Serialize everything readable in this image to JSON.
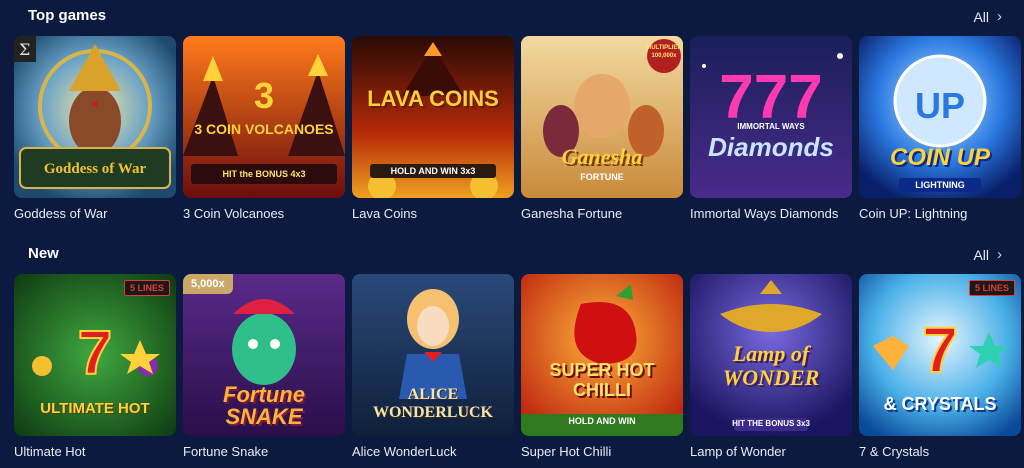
{
  "colors": {
    "background": "#0b1a3e",
    "label": "#e8ecf6",
    "accent": "#e53935"
  },
  "sections": {
    "top": {
      "title": "Top games",
      "all_label": "All",
      "games": [
        {
          "name": "Goddess of War",
          "art_text": "Goddess of War"
        },
        {
          "name": "3 Coin Volcanoes",
          "art_text": "3 COIN VOLCANOES",
          "art_sub": "HIT the BONUS 4x3"
        },
        {
          "name": "Lava Coins",
          "art_text": "LAVA COINS",
          "art_sub": "HOLD AND WIN 3x3"
        },
        {
          "name": "Ganesha Fortune",
          "art_text": "Ganesha",
          "art_sub": "FORTUNE",
          "art_badge": "MULTIPLIER 100,000x"
        },
        {
          "name": "Immortal Ways Diamonds",
          "art_text": "Diamonds",
          "art_sub": "IMMORTAL WAYS"
        },
        {
          "name": "Coin UP: Lightning",
          "art_text": "COIN UP",
          "art_sub": "LIGHTNING"
        }
      ]
    },
    "new": {
      "title": "New",
      "all_label": "All",
      "games": [
        {
          "name": "Ultimate Hot",
          "art_text": "ULTIMATE HOT",
          "badge": "5 LINES"
        },
        {
          "name": "Fortune Snake",
          "art_text": "Fortune SNAKE",
          "badge": "5,000x"
        },
        {
          "name": "Alice WonderLuck",
          "art_text": "ALICE WONDERLUCK"
        },
        {
          "name": "Super Hot Chilli",
          "art_text": "SUPER HOT CHILLI",
          "art_sub": "HOLD AND WIN"
        },
        {
          "name": "Lamp of Wonder",
          "art_text": "Lamp of WONDER",
          "art_sub": "HIT THE BONUS 3x3"
        },
        {
          "name": "7 & Crystals",
          "art_text": "& CRYSTALS",
          "badge": "5 LINES"
        }
      ]
    }
  },
  "chevron_icon": "chevron-right-icon"
}
